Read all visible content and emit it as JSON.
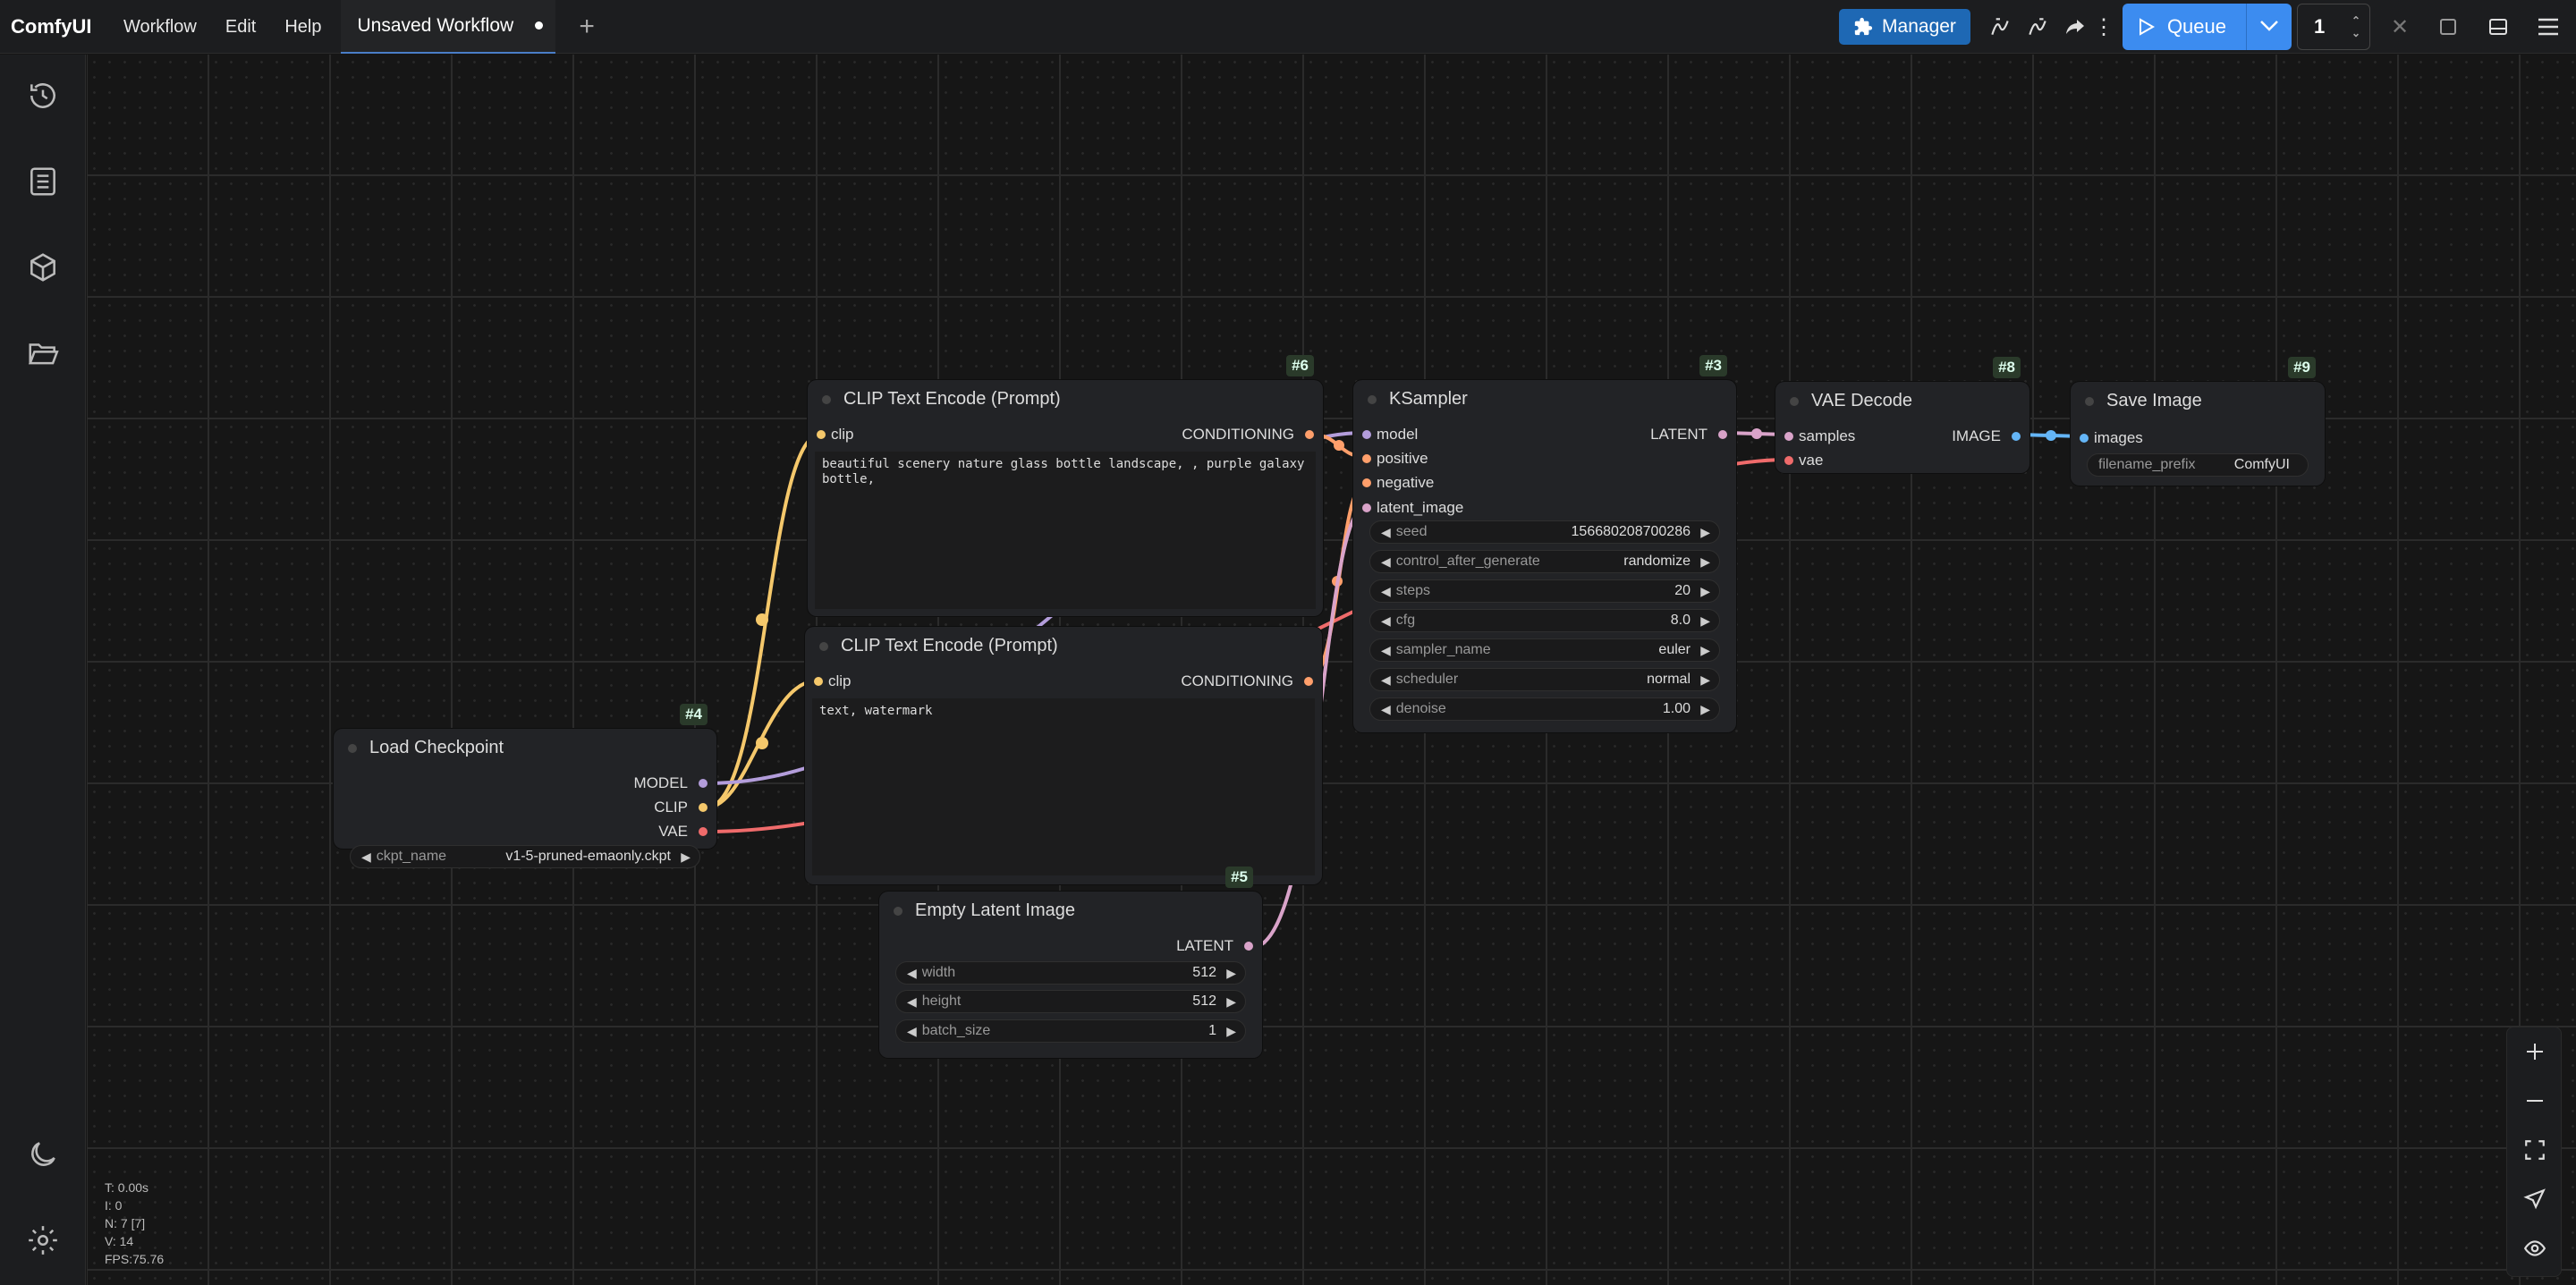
{
  "app": {
    "title": "ComfyUI"
  },
  "menu": [
    "Workflow",
    "Edit",
    "Help"
  ],
  "tab": {
    "label": "Unsaved Workflow"
  },
  "toolbar": {
    "manager_label": "Manager",
    "queue_label": "Queue",
    "queue_count": "1"
  },
  "colors": {
    "accent": "#3c8cf0",
    "manager": "#1e68b4",
    "clip": "#f5c86b",
    "model": "#b39ddb",
    "vae": "#ef6b6b",
    "conditioning": "#ff9f6b",
    "latent": "#d9a3c9",
    "image": "#64b5f6"
  },
  "sidebar_icons": [
    "history-icon",
    "queue-list-icon",
    "model-library-icon",
    "workflows-folder-icon",
    "theme-moon-icon",
    "settings-gear-icon"
  ],
  "nodes": {
    "clip_pos": {
      "id": "#6",
      "title": "CLIP Text Encode (Prompt)",
      "input": "clip",
      "output": "CONDITIONING",
      "text": "beautiful scenery nature glass bottle landscape, , purple galaxy bottle,"
    },
    "clip_neg": {
      "id": "#7",
      "title": "CLIP Text Encode (Prompt)",
      "input": "clip",
      "output": "CONDITIONING",
      "text": "text, watermark"
    },
    "ksampler": {
      "id": "#3",
      "title": "KSampler",
      "inputs": [
        "model",
        "positive",
        "negative",
        "latent_image"
      ],
      "output": "LATENT",
      "widgets": [
        {
          "label": "seed",
          "value": "156680208700286"
        },
        {
          "label": "control_after_generate",
          "value": "randomize"
        },
        {
          "label": "steps",
          "value": "20"
        },
        {
          "label": "cfg",
          "value": "8.0"
        },
        {
          "label": "sampler_name",
          "value": "euler"
        },
        {
          "label": "scheduler",
          "value": "normal"
        },
        {
          "label": "denoise",
          "value": "1.00"
        }
      ]
    },
    "vae_decode": {
      "id": "#8",
      "title": "VAE Decode",
      "inputs": [
        "samples",
        "vae"
      ],
      "output": "IMAGE"
    },
    "save_image": {
      "id": "#9",
      "title": "Save Image",
      "input": "images",
      "widget": {
        "label": "filename_prefix",
        "value": "ComfyUI"
      }
    },
    "load_checkpoint": {
      "id": "#4",
      "title": "Load Checkpoint",
      "outputs": [
        "MODEL",
        "CLIP",
        "VAE"
      ],
      "widget": {
        "label": "ckpt_name",
        "value": "v1-5-pruned-emaonly.ckpt"
      }
    },
    "empty_latent": {
      "id": "#5",
      "title": "Empty Latent Image",
      "output": "LATENT",
      "widgets": [
        {
          "label": "width",
          "value": "512"
        },
        {
          "label": "height",
          "value": "512"
        },
        {
          "label": "batch_size",
          "value": "1"
        }
      ]
    }
  },
  "stats": {
    "t": "T: 0.00s",
    "i": "I: 0",
    "n": "N: 7 [7]",
    "v": "V: 14",
    "fps": "FPS:75.76"
  }
}
